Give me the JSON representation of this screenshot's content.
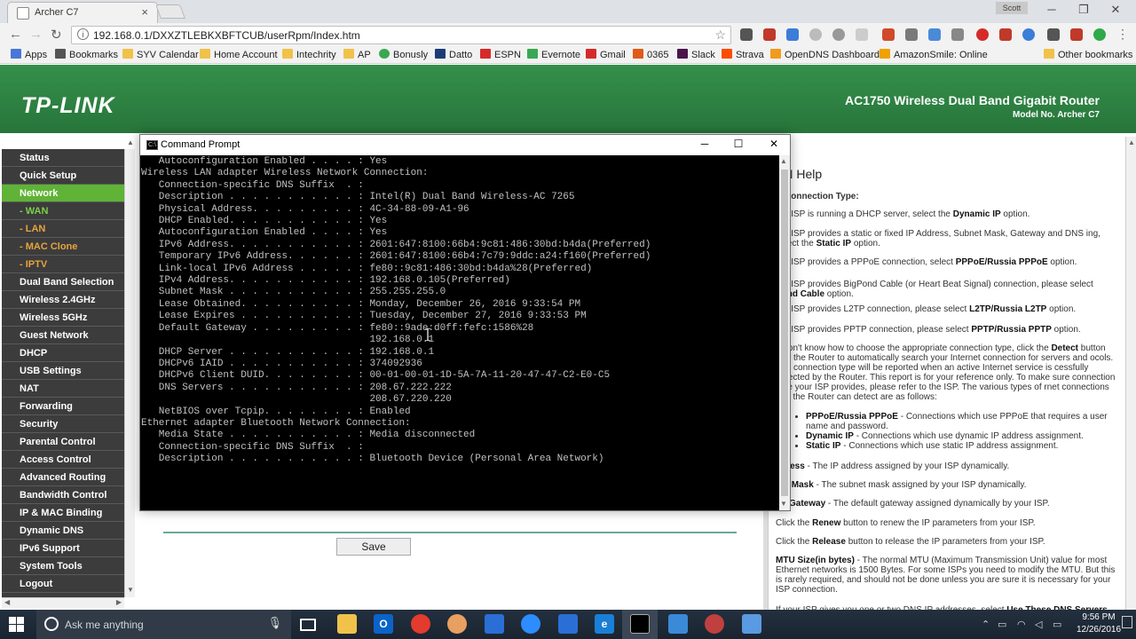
{
  "browser": {
    "tab_title": "Archer C7",
    "user_label": "Scott",
    "url": "192.168.0.1/DXXZTLEBKXBFTCUB/userRpm/Index.htm",
    "bookmarks": [
      {
        "label": "Apps",
        "color": "#4a76d8"
      },
      {
        "label": "Bookmarks",
        "color": "#555555"
      },
      {
        "label": "SYV Calendar",
        "color": "#f0c24a"
      },
      {
        "label": "Home Account",
        "color": "#f0c24a"
      },
      {
        "label": "Intechrity",
        "color": "#f0c24a"
      },
      {
        "label": "AP",
        "color": "#f0c24a"
      },
      {
        "label": "Bonusly",
        "color": "#3aa853"
      },
      {
        "label": "Datto",
        "color": "#1d3c77"
      },
      {
        "label": "ESPN",
        "color": "#d62a2a"
      },
      {
        "label": "Evernote",
        "color": "#3aa853"
      },
      {
        "label": "Gmail",
        "color": "#d62a2a"
      },
      {
        "label": "0365",
        "color": "#e05a18"
      },
      {
        "label": "Slack",
        "color": "#4a154b"
      },
      {
        "label": "Strava",
        "color": "#fc4c02"
      },
      {
        "label": "OpenDNS Dashboard",
        "color": "#f29a1e"
      },
      {
        "label": "AmazonSmile: Online",
        "color": "#f0a000"
      },
      {
        "label": "Other bookmarks",
        "color": "#f0c24a"
      }
    ]
  },
  "router": {
    "logo": "TP-LINK",
    "model_title": "AC1750 Wireless Dual Band Gigabit Router",
    "model_no": "Model No. Archer C7",
    "save_label": "Save",
    "nav": [
      {
        "label": "Status",
        "type": "main"
      },
      {
        "label": "Quick Setup",
        "type": "main"
      },
      {
        "label": "Network",
        "type": "active"
      },
      {
        "label": "- WAN",
        "type": "sub-active"
      },
      {
        "label": "- LAN",
        "type": "sub"
      },
      {
        "label": "- MAC Clone",
        "type": "sub"
      },
      {
        "label": "- IPTV",
        "type": "sub"
      },
      {
        "label": "Dual Band Selection",
        "type": "main"
      },
      {
        "label": "Wireless 2.4GHz",
        "type": "main"
      },
      {
        "label": "Wireless 5GHz",
        "type": "main"
      },
      {
        "label": "Guest Network",
        "type": "main"
      },
      {
        "label": "DHCP",
        "type": "main"
      },
      {
        "label": "USB Settings",
        "type": "main"
      },
      {
        "label": "NAT",
        "type": "main"
      },
      {
        "label": "Forwarding",
        "type": "main"
      },
      {
        "label": "Security",
        "type": "main"
      },
      {
        "label": "Parental Control",
        "type": "main"
      },
      {
        "label": "Access Control",
        "type": "main"
      },
      {
        "label": "Advanced Routing",
        "type": "main"
      },
      {
        "label": "Bandwidth Control",
        "type": "main"
      },
      {
        "label": "IP & MAC Binding",
        "type": "main"
      },
      {
        "label": "Dynamic DNS",
        "type": "main"
      },
      {
        "label": "IPv6 Support",
        "type": "main"
      },
      {
        "label": "System Tools",
        "type": "main"
      },
      {
        "label": "Logout",
        "type": "main"
      }
    ],
    "help": {
      "title": "AN Help",
      "conn_type_label": "N Connection Type:",
      "paragraphs": [
        "our ISP is running a DHCP server, select the <b>Dynamic IP</b> option.",
        "our ISP provides a static or fixed IP Address, Subnet Mask, Gateway and DNS ing, select the <b>Static IP</b> option.",
        "our ISP provides a PPPoE connection, select <b>PPPoE/Russia PPPoE</b> option.",
        "our ISP provides BigPond Cable (or Heart Beat Signal) connection, please select <b>Pond Cable</b> option.",
        "our ISP provides L2TP connection, please select <b>L2TP/Russia L2TP</b> option.",
        "our ISP provides PPTP connection, please select <b>PPTP/Russia PPTP</b> option.",
        "u don't know how to choose the appropriate connection type, click the <b>Detect</b> button llow the Router to automatically search your Internet connection for servers and ocols. The connection type will be reported when an active Internet service is cessfully detected by the Router. This report is for your reference only. To make sure connection type your ISP provides, please refer to the ISP. The various types of rnet connections that the Router can detect are as follows:"
      ],
      "list": [
        "<b>PPPoE/Russia PPPoE</b> - Connections which use PPPoE that requires a user name and password.",
        "<b>Dynamic IP</b> - Connections which use dynamic IP address assignment.",
        "<b>Static IP</b> - Connections which use static IP address assignment."
      ],
      "after": [
        "<b>ddress</b> - The IP address assigned by your ISP dynamically.",
        "<b>net Mask</b> - The subnet mask assigned by your ISP dynamically.",
        "<b>ult Gateway</b> - The default gateway assigned dynamically by your ISP.",
        "Click the <b>Renew</b> button to renew the IP parameters from your ISP.",
        "Click the <b>Release</b> button to release the IP parameters from your ISP.",
        "<b>MTU Size(in bytes)</b> - The normal MTU (Maximum Transmission Unit) value for most Ethernet networks is 1500 Bytes. For some ISPs you need to modify the MTU. But this is rarely required, and should not be done unless you are sure it is necessary for your ISP connection.",
        "If your ISP gives you one or two DNS IP addresses, select <b>Use These DNS Servers</b>"
      ]
    }
  },
  "cmd": {
    "title": "Command Prompt",
    "lines": [
      "   Autoconfiguration Enabled . . . . : Yes",
      "",
      "Wireless LAN adapter Wireless Network Connection:",
      "",
      "   Connection-specific DNS Suffix  . :",
      "   Description . . . . . . . . . . . : Intel(R) Dual Band Wireless-AC 7265",
      "   Physical Address. . . . . . . . . : 4C-34-88-09-A1-96",
      "   DHCP Enabled. . . . . . . . . . . : Yes",
      "   Autoconfiguration Enabled . . . . : Yes",
      "   IPv6 Address. . . . . . . . . . . : 2601:647:8100:66b4:9c81:486:30bd:b4da(Preferred)",
      "   Temporary IPv6 Address. . . . . . : 2601:647:8100:66b4:7c79:9ddc:a24:f160(Preferred)",
      "   Link-local IPv6 Address . . . . . : fe80::9c81:486:30bd:b4da%28(Preferred)",
      "   IPv4 Address. . . . . . . . . . . : 192.168.0.105(Preferred)",
      "   Subnet Mask . . . . . . . . . . . : 255.255.255.0",
      "   Lease Obtained. . . . . . . . . . : Monday, December 26, 2016 9:33:54 PM",
      "   Lease Expires . . . . . . . . . . : Tuesday, December 27, 2016 9:33:53 PM",
      "   Default Gateway . . . . . . . . . : fe80::9ade:d0ff:fefc:1586%28",
      "                                       192.168.0.1",
      "   DHCP Server . . . . . . . . . . . : 192.168.0.1",
      "   DHCPv6 IAID . . . . . . . . . . . : 374092936",
      "   DHCPv6 Client DUID. . . . . . . . : 00-01-00-01-1D-5A-7A-11-20-47-47-C2-E0-C5",
      "   DNS Servers . . . . . . . . . . . : 208.67.222.222",
      "                                       208.67.220.220",
      "   NetBIOS over Tcpip. . . . . . . . : Enabled",
      "",
      "Ethernet adapter Bluetooth Network Connection:",
      "",
      "   Media State . . . . . . . . . . . : Media disconnected",
      "   Connection-specific DNS Suffix  . :",
      "   Description . . . . . . . . . . . : Bluetooth Device (Personal Area Network)"
    ]
  },
  "taskbar": {
    "search_placeholder": "Ask me anything",
    "time": "9:56 PM",
    "date": "12/26/2016"
  }
}
